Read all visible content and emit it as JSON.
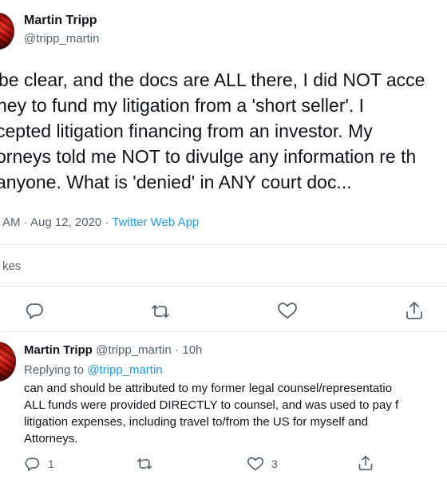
{
  "main_tweet": {
    "author_name": "Martin Tripp",
    "author_handle": "@tripp_martin",
    "text_lines": [
      "be clear, and the docs are ALL there, I did NOT acce",
      "ney to fund my litigation from a 'short seller'.  I",
      "cepted litigation financing from an investor.  My",
      "orneys told me NOT to divulge any information re th",
      "anyone.  What is 'denied' in ANY court doc..."
    ],
    "time": "AM · Aug 12, 2020 · ",
    "source": "Twitter Web App",
    "likes_label": "kes"
  },
  "reply": {
    "author_name": "Martin Tripp",
    "author_handle": "@tripp_martin",
    "time": "· 10h",
    "replying_prefix": "Replying to ",
    "replying_to": "@tripp_martin",
    "text_lines": [
      "can and should be attributed to my former legal counsel/representatio",
      "ALL funds were provided DIRECTLY to counsel, and was used to pay f",
      "litigation expenses, including travel to/from the US for myself and",
      "Attorneys."
    ],
    "reply_count": "1",
    "like_count": "3"
  },
  "icons": {
    "reply": "reply-icon",
    "retweet": "retweet-icon",
    "like": "heart-icon",
    "share": "share-icon"
  },
  "colors": {
    "link": "#1d9bf0",
    "secondary_text": "#536471",
    "divider": "#e6ecf0"
  }
}
